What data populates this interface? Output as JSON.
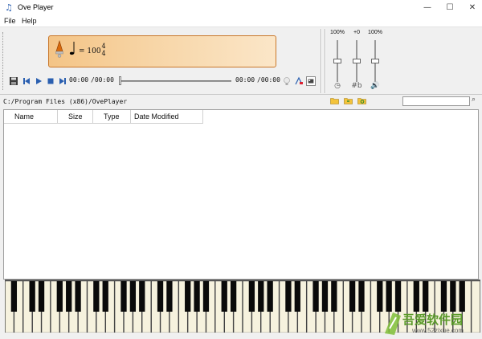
{
  "window": {
    "title": "Ove Player",
    "icon": "music-note-icon",
    "controls": {
      "minimize": "—",
      "maximize": "☐",
      "close": "✕"
    }
  },
  "menu": {
    "items": [
      "File",
      "Help"
    ]
  },
  "display": {
    "tempo_text": "= 100",
    "time_sig_top": "4",
    "time_sig_bottom": "4"
  },
  "transport": {
    "elapsed": "00:00",
    "total": "/00:00",
    "right_elapsed": "00:00",
    "right_total": "/00:00",
    "position": 0,
    "buttons": [
      "save-icon",
      "previous-icon",
      "play-icon",
      "stop-icon",
      "next-icon"
    ]
  },
  "mixer": {
    "labels": [
      "100%",
      "+0",
      "100%"
    ],
    "icons": [
      "◷",
      "#b",
      "🔊"
    ],
    "levels": [
      0.5,
      0.5,
      0.5
    ]
  },
  "path": {
    "text": "C:/Program Files (x86)/OvePlayer"
  },
  "search": {
    "placeholder": ""
  },
  "table": {
    "columns": [
      "Name",
      "Size",
      "Type",
      "Date Modified"
    ],
    "rows": []
  },
  "watermark": {
    "text": "吾爱软件园",
    "url": "www.52zixue.com"
  },
  "colors": {
    "display_start": "#f4c486",
    "display_end": "#fbe6c8",
    "accent_blue": "#2a5fb0",
    "white_key": "#f6f2de",
    "black_key": "#0a0a0a"
  }
}
